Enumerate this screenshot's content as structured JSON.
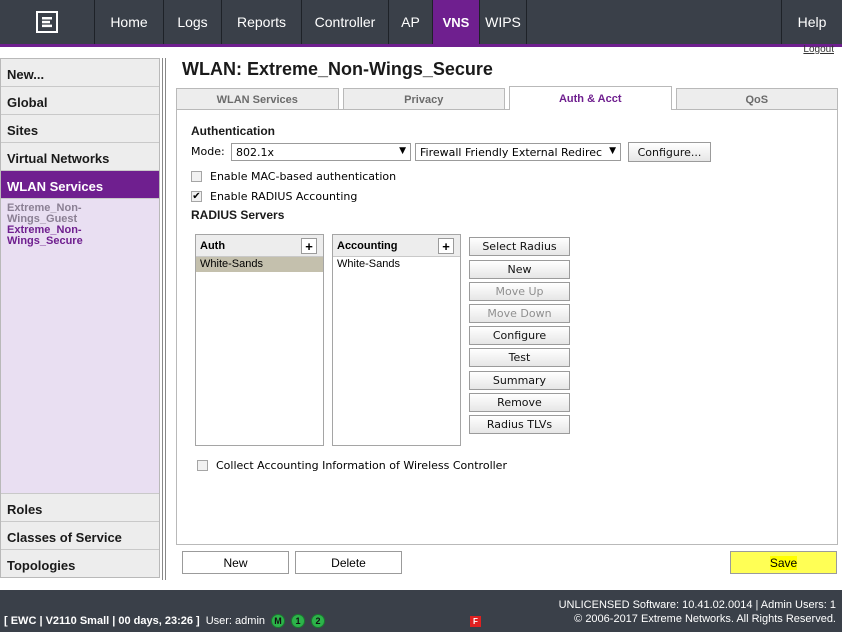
{
  "nav": {
    "logo_icon": "extreme-logo-icon",
    "items": [
      "Home",
      "Logs",
      "Reports",
      "Controller",
      "AP",
      "VNS",
      "WIPS"
    ],
    "active": "VNS",
    "help": "Help",
    "logout": "Logout"
  },
  "sidebar": {
    "top_items": [
      "New...",
      "Global",
      "Sites",
      "Virtual Networks",
      "WLAN Services"
    ],
    "active": "WLAN Services",
    "sub_items": [
      "Extreme_Non-Wings_Guest",
      "Extreme_Non-Wings_Secure"
    ],
    "current_sub": "Extreme_Non-Wings_Secure",
    "bottom_items": [
      "Roles",
      "Classes of Service",
      "Topologies"
    ]
  },
  "main": {
    "title": "WLAN: Extreme_Non-Wings_Secure",
    "tabs": [
      "WLAN Services",
      "Privacy",
      "Auth & Acct",
      "QoS"
    ],
    "active_tab": "Auth & Acct"
  },
  "auth": {
    "section_title": "Authentication",
    "mode_label": "Mode:",
    "mode_value": "802.1x",
    "redirect_value": "Firewall Friendly External Redirec",
    "configure_button": "Configure...",
    "mac_auth_label": "Enable MAC-based authentication",
    "mac_auth_checked": false,
    "radius_acct_label": "Enable RADIUS Accounting",
    "radius_acct_checked": true,
    "servers_title": "RADIUS Servers",
    "auth_list_header": "Auth",
    "auth_list": [
      "White-Sands"
    ],
    "acct_list_header": "Accounting",
    "acct_list": [
      "White-Sands"
    ],
    "plus": "+",
    "buttons": [
      "Select Radius",
      "New",
      "Move Up",
      "Move Down",
      "Configure",
      "Test",
      "Summary",
      "Remove",
      "Radius TLVs"
    ],
    "collect_label": "Collect Accounting Information of Wireless Controller",
    "collect_checked": false
  },
  "footer_buttons": {
    "new": "New",
    "delete": "Delete",
    "save": "Save"
  },
  "status": {
    "left_bold": "[ EWC | V2110 Small | 00 days, 23:26 ]",
    "user": "User: admin",
    "indicators": [
      "M",
      "1",
      "2"
    ],
    "alarm": "F",
    "right_line1": "UNLICENSED Software: 10.41.02.0014 | Admin Users: 1",
    "right_line2": "© 2006-2017  Extreme Networks. All Rights Reserved."
  },
  "colors": {
    "brand_purple": "#6f1f8f",
    "nav_bg": "#3a4049",
    "save_highlight": "#ffff00"
  }
}
